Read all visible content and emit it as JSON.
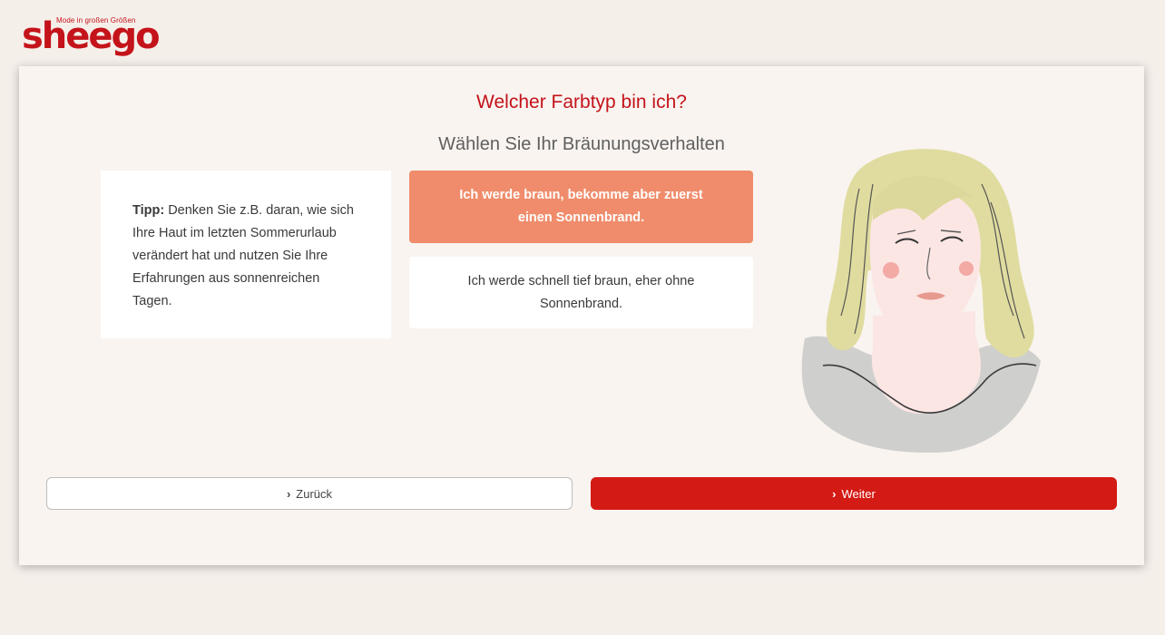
{
  "logo": {
    "tagline": "Mode in großen Größen",
    "wordmark": "sheego",
    "brand_color": "#c4131a"
  },
  "page": {
    "title": "Welcher Farbtyp bin ich?",
    "subtitle": "Wählen Sie Ihr Bräunungsverhalten"
  },
  "tip": {
    "label": "Tipp:",
    "text": " Denken Sie z.B. daran, wie sich Ihre Haut im letzten Sommerurlaub verändert hat und nutzen Sie Ihre Erfahrungen aus sonnenreichen Tagen."
  },
  "options": [
    {
      "label": "Ich werde braun, bekomme aber zuerst einen Sonnenbrand.",
      "selected": true
    },
    {
      "label": "Ich werde schnell tief braun, eher ohne Sonnenbrand.",
      "selected": false
    }
  ],
  "nav": {
    "back_label": "Zurück",
    "next_label": "Weiter",
    "chevron_icon": "chevron-right-icon"
  },
  "colors": {
    "accent": "#d41a14",
    "selected_option": "#f08c6b",
    "background": "#f5efea"
  }
}
